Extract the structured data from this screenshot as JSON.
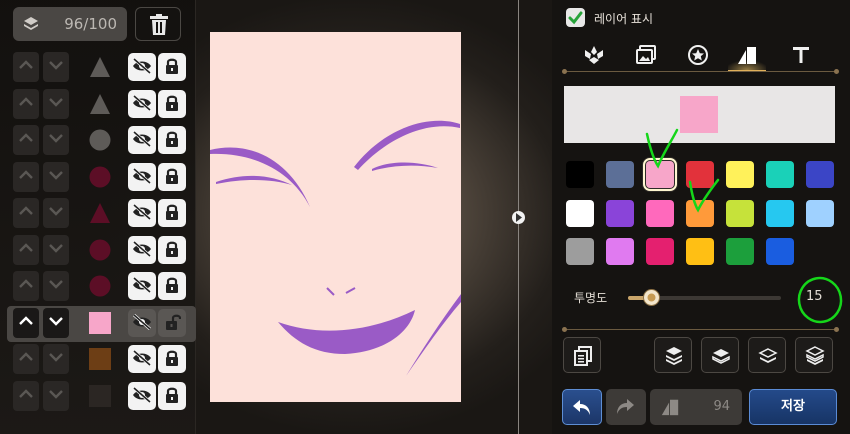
{
  "layer_count": {
    "value": "96/100"
  },
  "layers": [
    {
      "shape": "triangle",
      "color": "#5e5b58",
      "locked": true
    },
    {
      "shape": "triangle",
      "color": "#5e5b58",
      "locked": true
    },
    {
      "shape": "circle",
      "color": "#5e5b58",
      "locked": true
    },
    {
      "shape": "circle",
      "color": "#5c0e26",
      "locked": true
    },
    {
      "shape": "triangle",
      "color": "#5c0e26",
      "locked": true
    },
    {
      "shape": "circle",
      "color": "#5c0e26",
      "locked": true
    },
    {
      "shape": "circle",
      "color": "#5c0e26",
      "locked": true
    },
    {
      "shape": "square",
      "color": "#f7a6c9",
      "locked": false,
      "selected": true
    },
    {
      "shape": "square",
      "color": "#6d3e15",
      "locked": true
    },
    {
      "shape": "square",
      "color": "#2b2623",
      "locked": true
    }
  ],
  "right_panel": {
    "show_layer_label": "레이어 표시",
    "show_layer_checked": true,
    "tabs": [
      "emblem-tab",
      "image-tab",
      "badge-tab",
      "shape-tab",
      "text-tab"
    ],
    "active_tab": 3,
    "preview_color": "#f7a6c9",
    "palette": [
      "#000000",
      "#5c6f97",
      "#f7a6c9",
      "#e2323b",
      "#fff15a",
      "#1ad1b8",
      "#3b45c6",
      "#ffffff",
      "#8a44d9",
      "#ff69bc",
      "#ff9a3a",
      "#c6e23a",
      "#26c8f0",
      "#9fd1ff",
      "#9d9d9d",
      "#e07af0",
      "#e4206f",
      "#ffbf14",
      "#1c9f3c",
      "#1a5de0"
    ],
    "selected_swatch": 2,
    "opacity_label": "투명도",
    "opacity_value": "15",
    "opacity_fraction": 0.15,
    "shape_count": "94",
    "save_label": "저장",
    "accent_color": "#e1b15a"
  }
}
